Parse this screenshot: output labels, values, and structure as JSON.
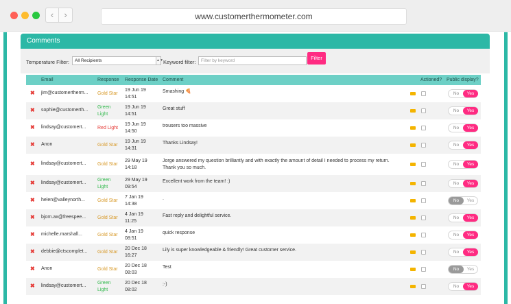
{
  "browser": {
    "url": "www.customerthermometer.com",
    "back_glyph": "‹",
    "forward_glyph": "›"
  },
  "panel": {
    "title": "Comments"
  },
  "filters": {
    "temperature_label": "Temperature Filter:",
    "temperature_value": "All Recipients",
    "keyword_label": "Keyword filter:",
    "keyword_placeholder": "Filter by keyword",
    "filter_button": "Filter"
  },
  "table": {
    "headers": {
      "email": "Email",
      "response": "Response",
      "response_date": "Response Date",
      "comment": "Comment",
      "actioned": "Actioned?",
      "public_display": "Public display?"
    },
    "toggle_labels": {
      "no": "No",
      "yes": "Yes"
    },
    "response_colors": {
      "Gold Star": "#d89a2a",
      "Green Light": "#2fb84a",
      "Red Light": "#e53935"
    },
    "rows": [
      {
        "email": "jim@customertherm...",
        "response": "Gold Star",
        "date": "19 Jun 19\n14:51",
        "comment": "Smashing 🍕",
        "public": "yes"
      },
      {
        "email": "sophie@customerth...",
        "response": "Green Light",
        "date": "19 Jun 19\n14:51",
        "comment": "Great stuff",
        "public": "yes"
      },
      {
        "email": "lindsay@customert...",
        "response": "Red Light",
        "date": "19 Jun 19\n14:50",
        "comment": "trousers too massive",
        "public": "yes"
      },
      {
        "email": "Anon",
        "response": "Gold Star",
        "date": "19 Jun 19\n14:31",
        "comment": "Thanks Lindsay!",
        "public": "yes"
      },
      {
        "email": "lindsay@customert...",
        "response": "Gold Star",
        "date": "29 May 19\n14:18",
        "comment": "Jorge answered my question brilliantly and with exactly the amount of detail I needed to process my return.\nThank you so much.",
        "public": "yes"
      },
      {
        "email": "lindsay@customert...",
        "response": "Green Light",
        "date": "29 May 19\n09:54",
        "comment": "Excellent work from the team! :)",
        "public": "yes"
      },
      {
        "email": "helen@valleynorth...",
        "response": "Gold Star",
        "date": "7 Jan 19\n14:38",
        "comment": ".",
        "public": "no"
      },
      {
        "email": "bjorn.ax@freespee...",
        "response": "Gold Star",
        "date": "4 Jan 19\n11:25",
        "comment": "Fast reply and delightful service.",
        "public": "yes"
      },
      {
        "email": "michelle.marshall...",
        "response": "Gold Star",
        "date": "4 Jan 19\n08:51",
        "comment": "quick response",
        "public": "yes"
      },
      {
        "email": "debbie@ctscomplet...",
        "response": "Gold Star",
        "date": "20 Dec 18\n16:27",
        "comment": "Lily is super knowledgeable & friendly! Great customer service.",
        "public": "yes"
      },
      {
        "email": "Anon",
        "response": "Gold Star",
        "date": "20 Dec 18\n08:03",
        "comment": "Test",
        "public": "no"
      },
      {
        "email": "lindsay@customert...",
        "response": "Green Light",
        "date": "20 Dec 18\n08:02",
        "comment": ":-)",
        "public": "yes"
      }
    ]
  }
}
